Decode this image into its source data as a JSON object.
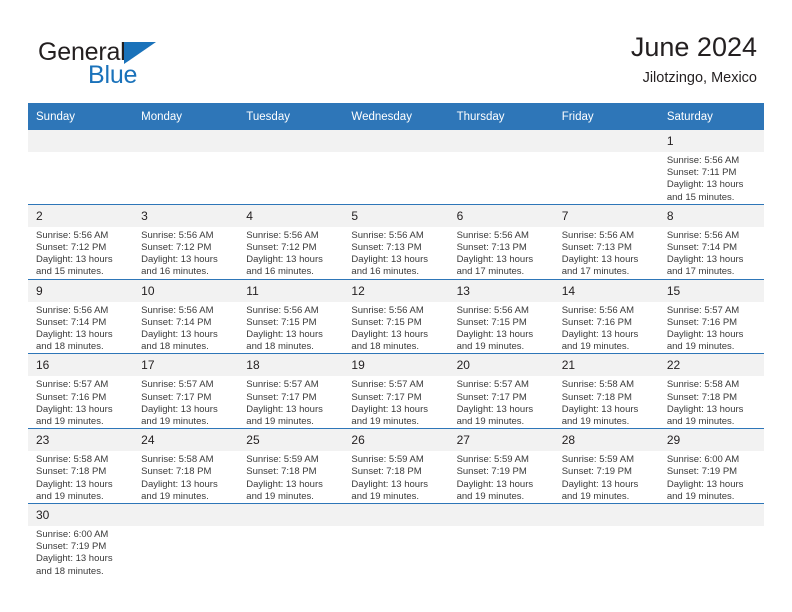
{
  "logo": {
    "part1": "General",
    "part2": "Blue",
    "triangle_color": "#1a72ba",
    "text_color": "#231f20"
  },
  "header": {
    "title": "June 2024",
    "subtitle": "Jilotzingo, Mexico"
  },
  "theme": {
    "header_blue": "#2e76b8",
    "daynum_band": "#f2f2f2",
    "body_text": "#3a3a3a"
  },
  "labels": {
    "sunrise": "Sunrise:",
    "sunset": "Sunset:",
    "daylight": "Daylight:"
  },
  "weekdays": [
    "Sunday",
    "Monday",
    "Tuesday",
    "Wednesday",
    "Thursday",
    "Friday",
    "Saturday"
  ],
  "weeks": [
    [
      {
        "day": ""
      },
      {
        "day": ""
      },
      {
        "day": ""
      },
      {
        "day": ""
      },
      {
        "day": ""
      },
      {
        "day": ""
      },
      {
        "day": "1",
        "sunrise": "Sunrise: 5:56 AM",
        "sunset": "Sunset: 7:11 PM",
        "daylight1": "Daylight: 13 hours",
        "daylight2": "and 15 minutes."
      }
    ],
    [
      {
        "day": "2",
        "sunrise": "Sunrise: 5:56 AM",
        "sunset": "Sunset: 7:12 PM",
        "daylight1": "Daylight: 13 hours",
        "daylight2": "and 15 minutes."
      },
      {
        "day": "3",
        "sunrise": "Sunrise: 5:56 AM",
        "sunset": "Sunset: 7:12 PM",
        "daylight1": "Daylight: 13 hours",
        "daylight2": "and 16 minutes."
      },
      {
        "day": "4",
        "sunrise": "Sunrise: 5:56 AM",
        "sunset": "Sunset: 7:12 PM",
        "daylight1": "Daylight: 13 hours",
        "daylight2": "and 16 minutes."
      },
      {
        "day": "5",
        "sunrise": "Sunrise: 5:56 AM",
        "sunset": "Sunset: 7:13 PM",
        "daylight1": "Daylight: 13 hours",
        "daylight2": "and 16 minutes."
      },
      {
        "day": "6",
        "sunrise": "Sunrise: 5:56 AM",
        "sunset": "Sunset: 7:13 PM",
        "daylight1": "Daylight: 13 hours",
        "daylight2": "and 17 minutes."
      },
      {
        "day": "7",
        "sunrise": "Sunrise: 5:56 AM",
        "sunset": "Sunset: 7:13 PM",
        "daylight1": "Daylight: 13 hours",
        "daylight2": "and 17 minutes."
      },
      {
        "day": "8",
        "sunrise": "Sunrise: 5:56 AM",
        "sunset": "Sunset: 7:14 PM",
        "daylight1": "Daylight: 13 hours",
        "daylight2": "and 17 minutes."
      }
    ],
    [
      {
        "day": "9",
        "sunrise": "Sunrise: 5:56 AM",
        "sunset": "Sunset: 7:14 PM",
        "daylight1": "Daylight: 13 hours",
        "daylight2": "and 18 minutes."
      },
      {
        "day": "10",
        "sunrise": "Sunrise: 5:56 AM",
        "sunset": "Sunset: 7:14 PM",
        "daylight1": "Daylight: 13 hours",
        "daylight2": "and 18 minutes."
      },
      {
        "day": "11",
        "sunrise": "Sunrise: 5:56 AM",
        "sunset": "Sunset: 7:15 PM",
        "daylight1": "Daylight: 13 hours",
        "daylight2": "and 18 minutes."
      },
      {
        "day": "12",
        "sunrise": "Sunrise: 5:56 AM",
        "sunset": "Sunset: 7:15 PM",
        "daylight1": "Daylight: 13 hours",
        "daylight2": "and 18 minutes."
      },
      {
        "day": "13",
        "sunrise": "Sunrise: 5:56 AM",
        "sunset": "Sunset: 7:15 PM",
        "daylight1": "Daylight: 13 hours",
        "daylight2": "and 19 minutes."
      },
      {
        "day": "14",
        "sunrise": "Sunrise: 5:56 AM",
        "sunset": "Sunset: 7:16 PM",
        "daylight1": "Daylight: 13 hours",
        "daylight2": "and 19 minutes."
      },
      {
        "day": "15",
        "sunrise": "Sunrise: 5:57 AM",
        "sunset": "Sunset: 7:16 PM",
        "daylight1": "Daylight: 13 hours",
        "daylight2": "and 19 minutes."
      }
    ],
    [
      {
        "day": "16",
        "sunrise": "Sunrise: 5:57 AM",
        "sunset": "Sunset: 7:16 PM",
        "daylight1": "Daylight: 13 hours",
        "daylight2": "and 19 minutes."
      },
      {
        "day": "17",
        "sunrise": "Sunrise: 5:57 AM",
        "sunset": "Sunset: 7:17 PM",
        "daylight1": "Daylight: 13 hours",
        "daylight2": "and 19 minutes."
      },
      {
        "day": "18",
        "sunrise": "Sunrise: 5:57 AM",
        "sunset": "Sunset: 7:17 PM",
        "daylight1": "Daylight: 13 hours",
        "daylight2": "and 19 minutes."
      },
      {
        "day": "19",
        "sunrise": "Sunrise: 5:57 AM",
        "sunset": "Sunset: 7:17 PM",
        "daylight1": "Daylight: 13 hours",
        "daylight2": "and 19 minutes."
      },
      {
        "day": "20",
        "sunrise": "Sunrise: 5:57 AM",
        "sunset": "Sunset: 7:17 PM",
        "daylight1": "Daylight: 13 hours",
        "daylight2": "and 19 minutes."
      },
      {
        "day": "21",
        "sunrise": "Sunrise: 5:58 AM",
        "sunset": "Sunset: 7:18 PM",
        "daylight1": "Daylight: 13 hours",
        "daylight2": "and 19 minutes."
      },
      {
        "day": "22",
        "sunrise": "Sunrise: 5:58 AM",
        "sunset": "Sunset: 7:18 PM",
        "daylight1": "Daylight: 13 hours",
        "daylight2": "and 19 minutes."
      }
    ],
    [
      {
        "day": "23",
        "sunrise": "Sunrise: 5:58 AM",
        "sunset": "Sunset: 7:18 PM",
        "daylight1": "Daylight: 13 hours",
        "daylight2": "and 19 minutes."
      },
      {
        "day": "24",
        "sunrise": "Sunrise: 5:58 AM",
        "sunset": "Sunset: 7:18 PM",
        "daylight1": "Daylight: 13 hours",
        "daylight2": "and 19 minutes."
      },
      {
        "day": "25",
        "sunrise": "Sunrise: 5:59 AM",
        "sunset": "Sunset: 7:18 PM",
        "daylight1": "Daylight: 13 hours",
        "daylight2": "and 19 minutes."
      },
      {
        "day": "26",
        "sunrise": "Sunrise: 5:59 AM",
        "sunset": "Sunset: 7:18 PM",
        "daylight1": "Daylight: 13 hours",
        "daylight2": "and 19 minutes."
      },
      {
        "day": "27",
        "sunrise": "Sunrise: 5:59 AM",
        "sunset": "Sunset: 7:19 PM",
        "daylight1": "Daylight: 13 hours",
        "daylight2": "and 19 minutes."
      },
      {
        "day": "28",
        "sunrise": "Sunrise: 5:59 AM",
        "sunset": "Sunset: 7:19 PM",
        "daylight1": "Daylight: 13 hours",
        "daylight2": "and 19 minutes."
      },
      {
        "day": "29",
        "sunrise": "Sunrise: 6:00 AM",
        "sunset": "Sunset: 7:19 PM",
        "daylight1": "Daylight: 13 hours",
        "daylight2": "and 19 minutes."
      }
    ],
    [
      {
        "day": "30",
        "sunrise": "Sunrise: 6:00 AM",
        "sunset": "Sunset: 7:19 PM",
        "daylight1": "Daylight: 13 hours",
        "daylight2": "and 18 minutes."
      },
      {
        "day": ""
      },
      {
        "day": ""
      },
      {
        "day": ""
      },
      {
        "day": ""
      },
      {
        "day": ""
      },
      {
        "day": ""
      }
    ]
  ]
}
